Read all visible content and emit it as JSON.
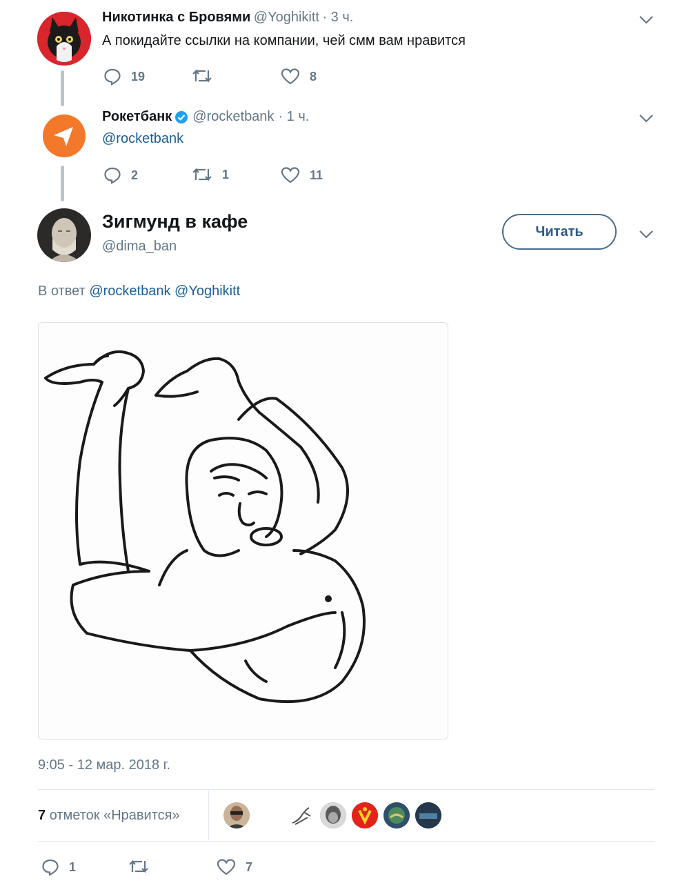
{
  "tweet1": {
    "name": "Никотинка с Бровями",
    "handle": "@Yoghikitt",
    "time": "· 3 ч.",
    "text": "А покидайте ссылки на компании, чей смм вам нравится",
    "replies": "19",
    "retweets": "",
    "likes": "8"
  },
  "tweet2": {
    "name": "Рокетбанк",
    "handle": "@rocketbank",
    "time": "· 1 ч.",
    "text": "@rocketbank",
    "replies": "2",
    "retweets": "1",
    "likes": "11",
    "verified": true
  },
  "main": {
    "name": "Зигмунд в кафе",
    "handle": "@dima_ban",
    "follow_label": "Читать",
    "reply_prefix": "В ответ",
    "reply_to_1": "@rocketbank",
    "reply_to_2": "@Yoghikitt",
    "timestamp": "9:05 - 12 мар. 2018 г.",
    "likes_count": "7",
    "likes_label": "отметок «Нравится»",
    "replies": "1",
    "retweets": "",
    "likes": "7"
  },
  "colors": {
    "rocketbank_orange": "#f3782a",
    "link_blue": "#1b5e96",
    "muted": "#657786",
    "verified_blue": "#1da1f2"
  },
  "icons": [
    "reply-icon",
    "retweet-icon",
    "like-icon",
    "chevron-down-icon",
    "verified-badge-icon"
  ]
}
